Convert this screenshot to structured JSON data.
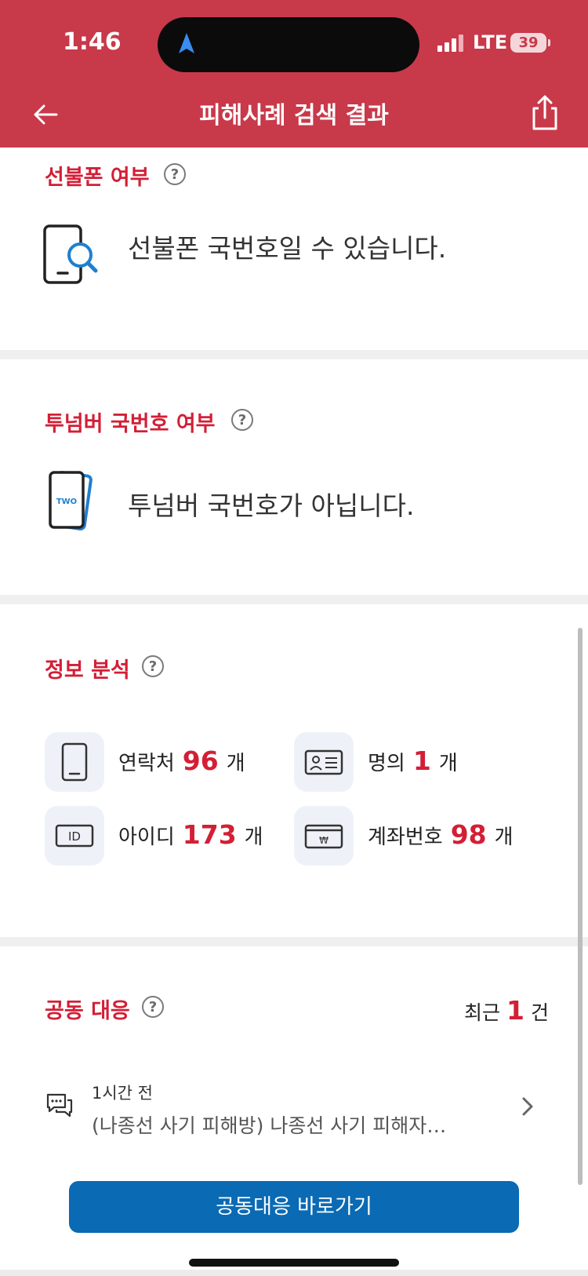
{
  "status_bar": {
    "time": "1:46",
    "network": "LTE",
    "battery": "39"
  },
  "header": {
    "title": "피해사례 검색 결과"
  },
  "prepaid": {
    "title": "선불폰 여부",
    "help": "?",
    "message": "선불폰 국번호일 수 있습니다.",
    "icon": "phone-search-icon"
  },
  "two_number": {
    "title": "투넘버 국번호 여부",
    "help": "?",
    "message": "투넘버 국번호가 아닙니다.",
    "icon_text": "TWO"
  },
  "info_analysis": {
    "title": "정보 분석",
    "help": "?",
    "stats": [
      {
        "label": "연락처",
        "value": "96",
        "unit": "개",
        "icon": "phone-icon"
      },
      {
        "label": "명의",
        "value": "1",
        "unit": "개",
        "icon": "id-card-icon"
      },
      {
        "label": "아이디",
        "value": "173",
        "unit": "개",
        "icon": "id-icon",
        "icon_text": "ID"
      },
      {
        "label": "계좌번호",
        "value": "98",
        "unit": "개",
        "icon": "bank-card-icon",
        "icon_text": "₩"
      }
    ]
  },
  "joint_response": {
    "title": "공동 대응",
    "help": "?",
    "recent_label": "최근",
    "recent_count": "1",
    "recent_unit": "건",
    "item": {
      "time": "1시간 전",
      "text": "(나종선 사기 피해방) 나종선 사기 피해자…"
    },
    "button_label": "공동대응 바로가기"
  },
  "colors": {
    "header": "#c8394a",
    "accent_red": "#d31f36",
    "button_blue": "#0a6ab4"
  }
}
